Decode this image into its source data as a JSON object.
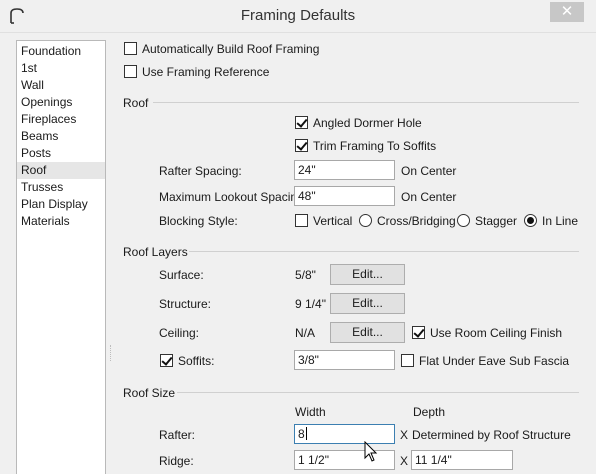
{
  "window": {
    "title": "Framing Defaults",
    "close_label": "✕",
    "app_icon": "arch-icon"
  },
  "sidebar": {
    "items": [
      {
        "label": "Foundation"
      },
      {
        "label": "1st"
      },
      {
        "label": "Wall"
      },
      {
        "label": "Openings"
      },
      {
        "label": "Fireplaces"
      },
      {
        "label": "Beams"
      },
      {
        "label": "Posts"
      },
      {
        "label": "Roof",
        "selected": true
      },
      {
        "label": "Trusses"
      },
      {
        "label": "Plan Display"
      },
      {
        "label": "Materials"
      }
    ]
  },
  "top_options": {
    "auto_build": {
      "label": "Automatically Build Roof Framing",
      "checked": false
    },
    "framing_ref": {
      "label": "Use Framing Reference",
      "checked": false
    }
  },
  "roof": {
    "title": "Roof",
    "angled_dormer": {
      "label": "Angled Dormer Hole",
      "checked": true
    },
    "trim_soffits": {
      "label": "Trim Framing To Soffits",
      "checked": true
    },
    "rafter_spacing": {
      "label": "Rafter Spacing:",
      "value": "24\"",
      "suffix": "On Center"
    },
    "lookout_spacing": {
      "label": "Maximum Lookout Spacing:",
      "value": "48\"",
      "suffix": "On Center"
    },
    "blocking": {
      "label": "Blocking Style:",
      "vertical": {
        "label": "Vertical",
        "checked": false
      },
      "options": [
        {
          "label": "Cross/Bridging",
          "selected": false
        },
        {
          "label": "Stagger",
          "selected": false
        },
        {
          "label": "In Line",
          "selected": true
        }
      ]
    }
  },
  "roof_layers": {
    "title": "Roof Layers",
    "surface": {
      "label": "Surface:",
      "value": "5/8\"",
      "button": "Edit..."
    },
    "structure": {
      "label": "Structure:",
      "value": "9 1/4\"",
      "button": "Edit..."
    },
    "ceiling": {
      "label": "Ceiling:",
      "value": "N/A",
      "button": "Edit...",
      "room_ceiling": {
        "label": "Use Room Ceiling Finish",
        "checked": true
      }
    },
    "soffits": {
      "label": "Soffits:",
      "checked": true,
      "value": "3/8\"",
      "flat_eave": {
        "label": "Flat Under Eave Sub Fascia",
        "checked": false
      }
    }
  },
  "roof_size": {
    "title": "Roof Size",
    "width_header": "Width",
    "depth_header": "Depth",
    "rafter": {
      "label": "Rafter:",
      "width": "8",
      "x": "X",
      "depth": "Determined by Roof Structure"
    },
    "ridge": {
      "label": "Ridge:",
      "width": "1 1/2\"",
      "x": "X",
      "depth": "11 1/4\""
    }
  }
}
